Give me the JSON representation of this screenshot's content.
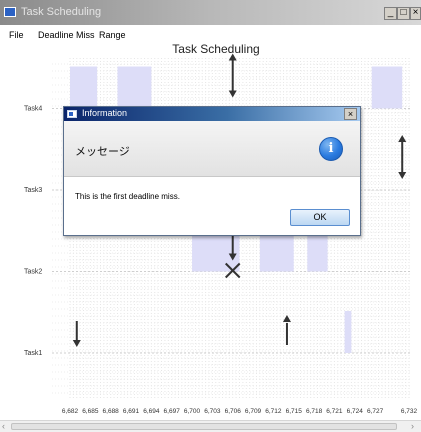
{
  "window": {
    "title": "Task Scheduling",
    "buttons": {
      "minimize": "_",
      "maximize": "□",
      "close": "×"
    }
  },
  "menu": [
    {
      "label": "File"
    },
    {
      "label": "Deadline Miss"
    },
    {
      "label": "Range"
    }
  ],
  "chart_data": {
    "type": "gantt",
    "title": "Task Scheduling",
    "xlabel": "",
    "ylabel": "",
    "tasks": [
      "Task1",
      "Task2",
      "Task3",
      "Task4"
    ],
    "xlim": [
      6682,
      6732
    ],
    "x_ticks": [
      "6,682",
      "6,685",
      "6,688",
      "6,691",
      "6,694",
      "6,697",
      "6,700",
      "6,703",
      "6,706",
      "6,709",
      "6,712",
      "6,715",
      "6,718",
      "6,721",
      "6,724",
      "6,727",
      "6,732"
    ],
    "grid": true,
    "bar_color": "#ddddf8",
    "bars": [
      {
        "task": "Task4",
        "start": 6682,
        "end": 6686
      },
      {
        "task": "Task4",
        "start": 6689,
        "end": 6694
      },
      {
        "task": "Task4",
        "start": 6726.5,
        "end": 6731
      },
      {
        "task": "Task2",
        "start": 6700,
        "end": 6707
      },
      {
        "task": "Task2",
        "start": 6710,
        "end": 6715
      },
      {
        "task": "Task2",
        "start": 6717,
        "end": 6720
      },
      {
        "task": "Task1",
        "start": 6722.5,
        "end": 6723.5
      }
    ],
    "events": [
      {
        "kind": "release-deadline",
        "task": "Task4",
        "x": 6706
      },
      {
        "kind": "release-deadline",
        "task": "Task3",
        "x": 6731
      },
      {
        "kind": "release-deadline",
        "task": "Task2",
        "x": 6706
      },
      {
        "kind": "deadline-miss",
        "task": "Task2",
        "x": 6706
      },
      {
        "kind": "deadline",
        "task": "Task1",
        "x": 6683
      },
      {
        "kind": "release",
        "task": "Task1",
        "x": 6714
      }
    ]
  },
  "dialog": {
    "title": "Information",
    "header": "メッセージ",
    "message": "This is the first deadline miss.",
    "ok_label": "OK",
    "info_icon": "i",
    "close_label": "×"
  },
  "scrollbar": {
    "left_arrow": "‹",
    "right_arrow": "›"
  }
}
